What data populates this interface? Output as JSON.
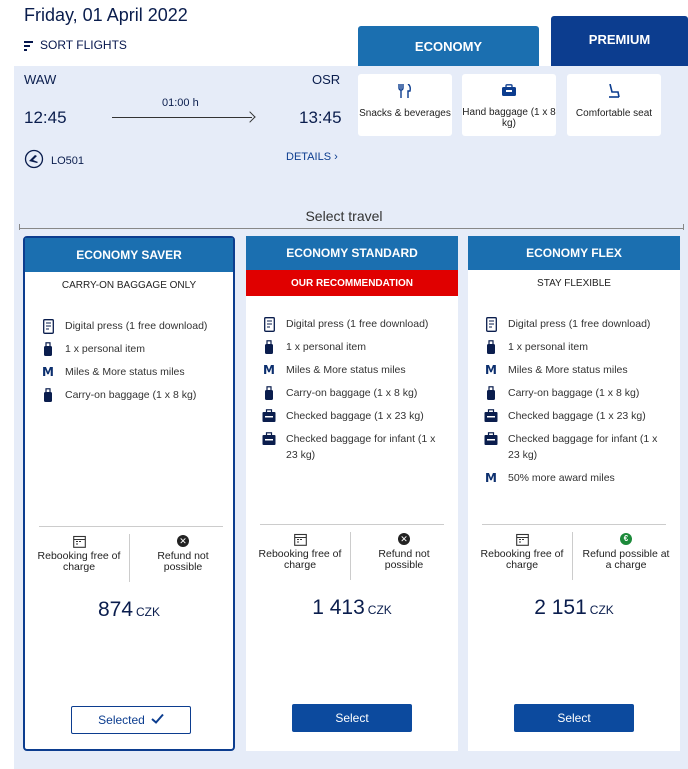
{
  "header": {
    "date": "Friday, 01 April 2022",
    "sort_label": "SORT FLIGHTS"
  },
  "tabs": [
    {
      "label": "ECONOMY"
    },
    {
      "label": "PREMIUM"
    }
  ],
  "flight": {
    "from": "WAW",
    "to": "OSR",
    "depart": "12:45",
    "arrive": "13:45",
    "duration": "01:00 h",
    "number": "LO501",
    "details_label": "DETAILS ›"
  },
  "features": [
    {
      "label": "Snacks & beverages",
      "icon": "cutlery-icon"
    },
    {
      "label": "Hand baggage (1 x 8 kg)",
      "icon": "hand-baggage-icon"
    },
    {
      "label": "Comfortable seat",
      "icon": "seat-icon"
    }
  ],
  "select_travel": "Select travel",
  "fares": [
    {
      "name": "ECONOMY SAVER",
      "subtitle": "CARRY-ON BAGGAGE ONLY",
      "items": [
        {
          "text": "Digital press (1 free download)",
          "icon": "tablet-icon"
        },
        {
          "text": "1 x personal item",
          "icon": "bag-icon"
        },
        {
          "text": "Miles & More status miles",
          "icon": "miles-icon"
        },
        {
          "text": "Carry-on baggage (1 x 8 kg)",
          "icon": "bag-icon"
        }
      ],
      "rebook": "Rebooking free of charge",
      "refund": "Refund not possible",
      "refund_icon": "x-circle-icon",
      "price": "874",
      "currency": "CZK",
      "button": "Selected"
    },
    {
      "name": "ECONOMY STANDARD",
      "subtitle": "OUR RECOMMENDATION",
      "items": [
        {
          "text": "Digital press (1 free download)",
          "icon": "tablet-icon"
        },
        {
          "text": "1 x personal item",
          "icon": "bag-icon"
        },
        {
          "text": "Miles & More status miles",
          "icon": "miles-icon"
        },
        {
          "text": "Carry-on baggage (1 x 8 kg)",
          "icon": "bag-icon"
        },
        {
          "text": "Checked baggage (1 x 23 kg)",
          "icon": "suitcase-icon"
        },
        {
          "text": "Checked baggage for infant (1 x 23 kg)",
          "icon": "suitcase-icon"
        }
      ],
      "rebook": "Rebooking free of charge",
      "refund": "Refund not possible",
      "refund_icon": "x-circle-icon",
      "price": "1 413",
      "currency": "CZK",
      "button": "Select"
    },
    {
      "name": "ECONOMY FLEX",
      "subtitle": "STAY FLEXIBLE",
      "items": [
        {
          "text": "Digital press (1 free download)",
          "icon": "tablet-icon"
        },
        {
          "text": "1 x personal item",
          "icon": "bag-icon"
        },
        {
          "text": "Miles & More status miles",
          "icon": "miles-icon"
        },
        {
          "text": "Carry-on baggage (1 x 8 kg)",
          "icon": "bag-icon"
        },
        {
          "text": "Checked baggage (1 x 23 kg)",
          "icon": "suitcase-icon"
        },
        {
          "text": "Checked baggage for infant (1 x 23 kg)",
          "icon": "suitcase-icon"
        },
        {
          "text": "50% more award miles",
          "icon": "miles-icon"
        }
      ],
      "rebook": "Rebooking free of charge",
      "refund": "Refund possible at a charge",
      "refund_icon": "euro-circle-icon",
      "price": "2 151",
      "currency": "CZK",
      "button": "Select"
    }
  ],
  "colors": {
    "brand_dark": "#0c3d8f",
    "tab_blue": "#1b6fb0",
    "recommend_red": "#e00000",
    "panel_bg": "#e6ecf8"
  }
}
